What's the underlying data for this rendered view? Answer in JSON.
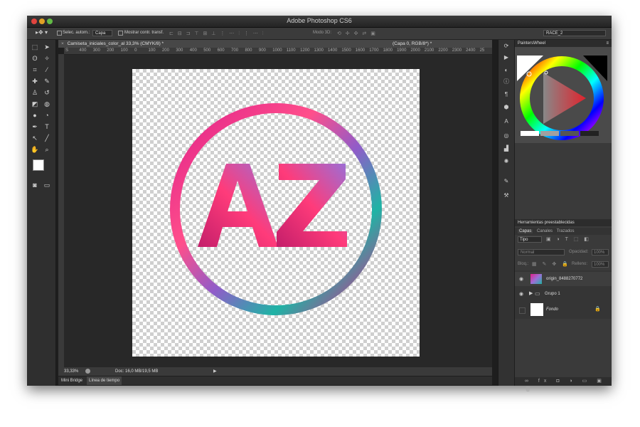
{
  "app": {
    "title": "Adobe Photoshop CS6"
  },
  "options_bar": {
    "auto_select_label": "Selec. autom.:",
    "auto_select_value": "Capa",
    "show_transform_label": "Mostrar contr. transf.",
    "mode3d_label": "Modo 3D:",
    "workspace_value": "RACE_2"
  },
  "document": {
    "tab_title": "Camiseta_iniciales_color_al 33,3% (CMYK/8) *",
    "tab_title_right": "(Capa 0, RGB/8*) *",
    "ruler_labels": [
      "S",
      "400",
      "300",
      "200",
      "100",
      "0",
      "100",
      "200",
      "300",
      "400",
      "500",
      "600",
      "700",
      "800",
      "900",
      "1000",
      "1100",
      "1200",
      "1300",
      "1400",
      "1500",
      "1600",
      "1700",
      "1800",
      "1900",
      "2000",
      "2100",
      "2200",
      "2300",
      "2400",
      "25"
    ],
    "canvas_text": "AZ"
  },
  "status": {
    "zoom": "33,33%",
    "doc_info": "Doc: 16,0 MB/19,5 MB"
  },
  "bottom_tabs": [
    "Mini Bridge",
    "Línea de tiempo"
  ],
  "panels": {
    "wheel_panel_title": "PaintersWheel",
    "presets_title": "Herramientas preestablecidas",
    "layers_tabs": [
      "Capas",
      "Canales",
      "Trazados"
    ],
    "kind_filter": "Tipo",
    "blend_mode": "Normal",
    "opacity_label": "Opacidad:",
    "opacity_value": "100%",
    "lock_label": "Bloq.:",
    "fill_label": "Relleno:",
    "fill_value": "100%",
    "layers": [
      {
        "name": "origin_8488270772"
      },
      {
        "name": "Grupo 1"
      },
      {
        "name": "Fondo"
      }
    ]
  },
  "colors": {
    "accent_pink": "#e0218a",
    "accent_teal": "#1fb3a5",
    "wheel_red": "#e0232d"
  }
}
